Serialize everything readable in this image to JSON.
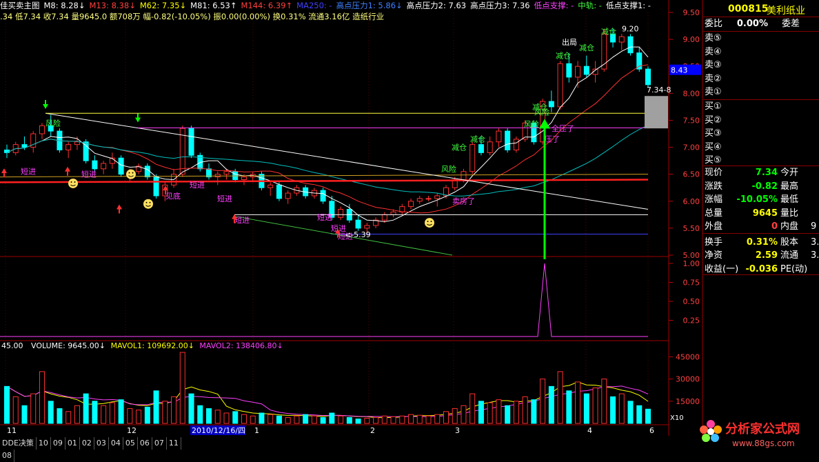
{
  "header": {
    "title": "佳买卖主图",
    "items": [
      {
        "text": "M8: 8.28↓",
        "color": "#ffffff"
      },
      {
        "text": "M13: 8.38↓",
        "color": "#ff4040"
      },
      {
        "text": "M62: 7.35↓",
        "color": "#ffff00"
      },
      {
        "text": "M81: 6.53↑",
        "color": "#ffffff"
      },
      {
        "text": "M144: 6.39↑",
        "color": "#ff4040"
      },
      {
        "text": "MA250: -",
        "color": "#4040ff"
      },
      {
        "text": "高点压力1: 5.86↓",
        "color": "#4080ff"
      },
      {
        "text": "高点压力2: 7.63",
        "color": "#ffffff"
      },
      {
        "text": "高点压力3: 7.36",
        "color": "#ffffff"
      },
      {
        "text": "低点支撑: -",
        "color": "#ff40ff"
      },
      {
        "text": "中轨: -",
        "color": "#40ff40"
      },
      {
        "text": "低点支撑1: -",
        "color": "#ffffff"
      }
    ],
    "line2": ".34 低7.34 收7.34 量9645.0 额708万 幅-0.82(-10.05%) 振0.00(0.00%) 换0.31% 流通3.16亿 造纸行业"
  },
  "stock": {
    "code": "000815",
    "name": "美利纸业"
  },
  "quote": {
    "wei_bi_label": "委比",
    "wei_bi": "0.00%",
    "wei_cha_label": "委差",
    "sells": [
      "卖⑤",
      "卖④",
      "卖③",
      "卖②",
      "卖①"
    ],
    "buys": [
      "买①",
      "买②",
      "买③",
      "买④",
      "买⑤"
    ],
    "rows": [
      {
        "l1": "现价",
        "v1": "7.34",
        "c1": "#00ff00",
        "l2": "今开",
        "v2": ""
      },
      {
        "l1": "涨跌",
        "v1": "-0.82",
        "c1": "#00ff00",
        "l2": "最高",
        "v2": ""
      },
      {
        "l1": "涨幅",
        "v1": "-10.05%",
        "c1": "#00ff00",
        "l2": "最低",
        "v2": ""
      },
      {
        "l1": "总量",
        "v1": "9645",
        "c1": "#ffff00",
        "l2": "量比",
        "v2": ""
      },
      {
        "l1": "外盘",
        "v1": "0",
        "c1": "#ff4040",
        "l2": "内盘",
        "v2": "9"
      },
      {
        "l1": "换手",
        "v1": "0.31%",
        "c1": "#ffff00",
        "l2": "股本",
        "v2": "3."
      },
      {
        "l1": "净资",
        "v1": "2.59",
        "c1": "#ffff00",
        "l2": "流通",
        "v2": "3."
      },
      {
        "l1": "收益(一)",
        "v1": "-0.036",
        "c1": "#ffff00",
        "l2": "PE(动)",
        "v2": ""
      }
    ]
  },
  "price_axis": {
    "ticks": [
      "9.50",
      "9.00",
      "8.50",
      "8.00",
      "7.50",
      "7.00",
      "6.50",
      "6.00",
      "5.50",
      "5.00"
    ],
    "current": "8.43"
  },
  "indicator_axis": {
    "ticks": [
      "1.00",
      "0.75",
      "0.50",
      "0.25"
    ]
  },
  "volume_axis": {
    "ticks": [
      "45000",
      "30000",
      "15000"
    ],
    "unit": "X10"
  },
  "volume_header": {
    "prefix": "45.00",
    "vol": "VOLUME: 9645.00↓",
    "mavol1": "MAVOL1: 109692.00↓",
    "mavol2": "MAVOL2: 138406.80↓"
  },
  "date_axis": {
    "labels": [
      "11",
      "12",
      "2010/12/16/四",
      "1",
      "2",
      "3",
      "4",
      "6"
    ]
  },
  "annotations": {
    "fengxian": "风险",
    "duanjin": "短进",
    "jiandi": "见底",
    "jiancang": "减仓",
    "chuju": "出局",
    "quanya": "全压了",
    "ya": "压了",
    "maifangle": "卖房了",
    "high_label": "9.20",
    "low_label": "5.39",
    "last_label": "7.34-8"
  },
  "bottom_tabs": [
    "DDE决策",
    "10",
    "09",
    "01",
    "02",
    "03",
    "04",
    "05",
    "06",
    "07",
    "11",
    "08"
  ],
  "watermark": {
    "title": "分析家公式网",
    "url": "www.88gs.com"
  },
  "chart_data": {
    "type": "candlestick",
    "y_range": [
      5.0,
      9.5
    ],
    "candles": [
      [
        6.95,
        7.05,
        6.8,
        6.9
      ],
      [
        6.9,
        7.1,
        6.85,
        7.05
      ],
      [
        7.05,
        7.2,
        6.95,
        7.0
      ],
      [
        7.0,
        7.3,
        6.9,
        7.25
      ],
      [
        7.25,
        7.45,
        7.15,
        7.4
      ],
      [
        7.4,
        7.6,
        7.2,
        7.3
      ],
      [
        7.3,
        7.35,
        6.9,
        6.95
      ],
      [
        6.95,
        7.1,
        6.8,
        7.05
      ],
      [
        7.05,
        7.2,
        6.95,
        7.1
      ],
      [
        7.1,
        7.15,
        6.7,
        6.75
      ],
      [
        6.75,
        6.85,
        6.55,
        6.6
      ],
      [
        6.6,
        6.75,
        6.5,
        6.7
      ],
      [
        6.7,
        6.9,
        6.6,
        6.8
      ],
      [
        6.8,
        6.85,
        6.45,
        6.5
      ],
      [
        6.5,
        6.6,
        6.35,
        6.55
      ],
      [
        6.55,
        6.7,
        6.5,
        6.65
      ],
      [
        6.65,
        6.7,
        6.4,
        6.45
      ],
      [
        6.45,
        6.5,
        6.05,
        6.1
      ],
      [
        6.1,
        6.35,
        6.0,
        6.3
      ],
      [
        6.3,
        6.6,
        6.25,
        6.5
      ],
      [
        6.5,
        7.4,
        6.45,
        7.35
      ],
      [
        7.35,
        7.4,
        6.8,
        6.85
      ],
      [
        6.85,
        6.9,
        6.55,
        6.6
      ],
      [
        6.6,
        6.7,
        6.4,
        6.45
      ],
      [
        6.45,
        6.55,
        6.3,
        6.5
      ],
      [
        6.5,
        6.6,
        6.4,
        6.55
      ],
      [
        6.55,
        6.6,
        6.35,
        6.4
      ],
      [
        6.4,
        6.5,
        6.3,
        6.45
      ],
      [
        6.45,
        6.55,
        6.35,
        6.5
      ],
      [
        6.5,
        6.55,
        6.2,
        6.25
      ],
      [
        6.25,
        6.35,
        6.1,
        6.3
      ],
      [
        6.3,
        6.35,
        6.0,
        6.05
      ],
      [
        6.05,
        6.2,
        5.95,
        6.15
      ],
      [
        6.15,
        6.3,
        6.1,
        6.25
      ],
      [
        6.25,
        6.3,
        6.05,
        6.1
      ],
      [
        6.1,
        6.25,
        6.05,
        6.2
      ],
      [
        6.2,
        6.25,
        5.95,
        6.0
      ],
      [
        6.0,
        6.1,
        5.65,
        5.7
      ],
      [
        5.7,
        5.9,
        5.65,
        5.85
      ],
      [
        5.85,
        5.95,
        5.6,
        5.65
      ],
      [
        5.65,
        5.75,
        5.45,
        5.5
      ],
      [
        5.5,
        5.6,
        5.39,
        5.55
      ],
      [
        5.55,
        5.7,
        5.5,
        5.65
      ],
      [
        5.65,
        5.8,
        5.6,
        5.75
      ],
      [
        5.75,
        5.85,
        5.7,
        5.8
      ],
      [
        5.8,
        5.95,
        5.75,
        5.9
      ],
      [
        5.9,
        6.05,
        5.85,
        6.0
      ],
      [
        6.0,
        6.1,
        5.95,
        6.05
      ],
      [
        6.05,
        6.1,
        6.0,
        6.05
      ],
      [
        6.05,
        6.15,
        5.9,
        6.1
      ],
      [
        6.1,
        6.3,
        6.05,
        6.25
      ],
      [
        6.25,
        6.45,
        6.2,
        6.4
      ],
      [
        6.4,
        6.6,
        6.35,
        6.55
      ],
      [
        6.55,
        7.1,
        6.5,
        7.05
      ],
      [
        7.05,
        7.2,
        6.85,
        6.9
      ],
      [
        6.9,
        7.2,
        6.85,
        7.1
      ],
      [
        7.1,
        7.35,
        7.0,
        7.3
      ],
      [
        7.3,
        7.35,
        6.9,
        6.95
      ],
      [
        6.95,
        7.2,
        6.9,
        7.15
      ],
      [
        7.15,
        7.5,
        7.1,
        7.45
      ],
      [
        7.45,
        7.5,
        7.05,
        7.1
      ],
      [
        7.1,
        7.9,
        7.05,
        7.85
      ],
      [
        7.85,
        8.05,
        7.65,
        7.75
      ],
      [
        7.75,
        8.6,
        7.7,
        8.55
      ],
      [
        8.55,
        8.75,
        8.2,
        8.3
      ],
      [
        8.3,
        8.6,
        8.1,
        8.5
      ],
      [
        8.5,
        8.7,
        8.3,
        8.35
      ],
      [
        8.35,
        8.6,
        8.2,
        8.45
      ],
      [
        8.45,
        9.2,
        8.4,
        9.1
      ],
      [
        9.1,
        9.2,
        8.85,
        8.95
      ],
      [
        8.95,
        9.1,
        8.8,
        9.05
      ],
      [
        9.05,
        9.1,
        8.7,
        8.75
      ],
      [
        8.75,
        8.85,
        8.4,
        8.45
      ],
      [
        8.45,
        8.5,
        8.1,
        8.16
      ]
    ],
    "volumes": [
      25000,
      18000,
      12000,
      20000,
      35000,
      15000,
      10000,
      8000,
      12000,
      20000,
      15000,
      12000,
      14000,
      16000,
      10000,
      9000,
      11000,
      22000,
      15000,
      18000,
      48000,
      20000,
      12000,
      10000,
      9000,
      7000,
      8000,
      6000,
      5000,
      7000,
      6000,
      5000,
      4000,
      5000,
      6000,
      5000,
      4000,
      7000,
      5000,
      4000,
      3000,
      3500,
      4000,
      5000,
      4500,
      5000,
      6000,
      5500,
      5000,
      6000,
      8000,
      10000,
      12000,
      20000,
      15000,
      14000,
      16000,
      12000,
      15000,
      18000,
      16000,
      30000,
      25000,
      35000,
      22000,
      28000,
      20000,
      24000,
      30000,
      18000,
      20000,
      15000,
      12000,
      9645
    ]
  }
}
